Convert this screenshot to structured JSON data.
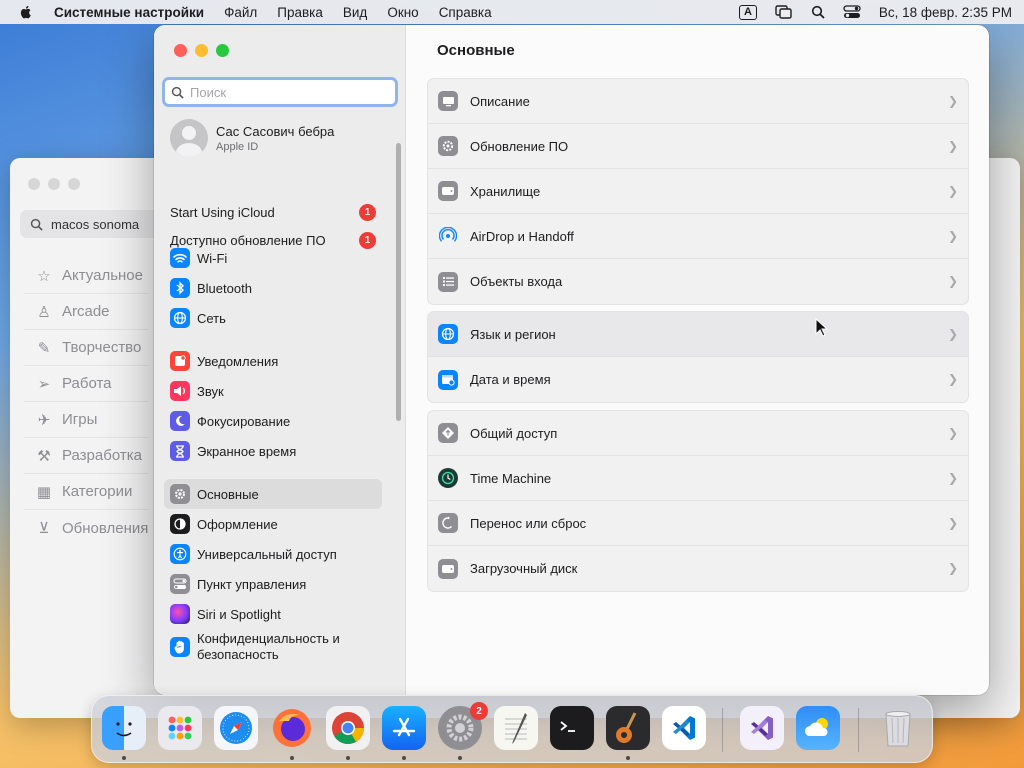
{
  "menubar": {
    "app_name": "Системные настройки",
    "items": [
      "Файл",
      "Правка",
      "Вид",
      "Окно",
      "Справка"
    ],
    "input_source": "A",
    "datetime": "Вс, 18 февр. 2:35 PM"
  },
  "background_window": {
    "search_value": "macos sonoma",
    "nav": [
      "Актуальное",
      "Arcade",
      "Творчество",
      "Работа",
      "Игры",
      "Разработка",
      "Категории",
      "Обновления"
    ]
  },
  "sidebar": {
    "search_placeholder": "Поиск",
    "account": {
      "name": "Сас Сасович бебра",
      "sub": "Apple ID"
    },
    "notices": [
      {
        "label": "Start Using iCloud",
        "badge": "1"
      },
      {
        "label": "Доступно обновление ПО",
        "badge": "1"
      }
    ],
    "group1": [
      "Wi‑Fi",
      "Bluetooth",
      "Сеть"
    ],
    "group2": [
      "Уведомления",
      "Звук",
      "Фокусирование",
      "Экранное время"
    ],
    "group3": [
      "Основные",
      "Оформление",
      "Универсальный доступ",
      "Пункт управления",
      "Siri и Spotlight",
      "Конфиденциальность и безопасность"
    ],
    "selected": "Основные"
  },
  "content": {
    "title": "Основные",
    "group1": [
      "Описание",
      "Обновление ПО",
      "Хранилище",
      "AirDrop и Handoff",
      "Объекты входа"
    ],
    "group2": [
      "Язык и регион",
      "Дата и время"
    ],
    "group3": [
      "Общий доступ",
      "Time Machine",
      "Перенос или сброс",
      "Загрузочный диск"
    ]
  },
  "dock": {
    "apps": [
      "Finder",
      "Launchpad",
      "Safari",
      "Firefox",
      "Chrome",
      "App Store",
      "System Settings",
      "TextEdit",
      "Terminal",
      "GarageBand",
      "VS Code",
      "Visual Studio",
      "Weather",
      "Trash"
    ],
    "settings_badge": "2"
  },
  "colors": {
    "accent": "#0a84ff",
    "badge": "#ee3b36"
  }
}
